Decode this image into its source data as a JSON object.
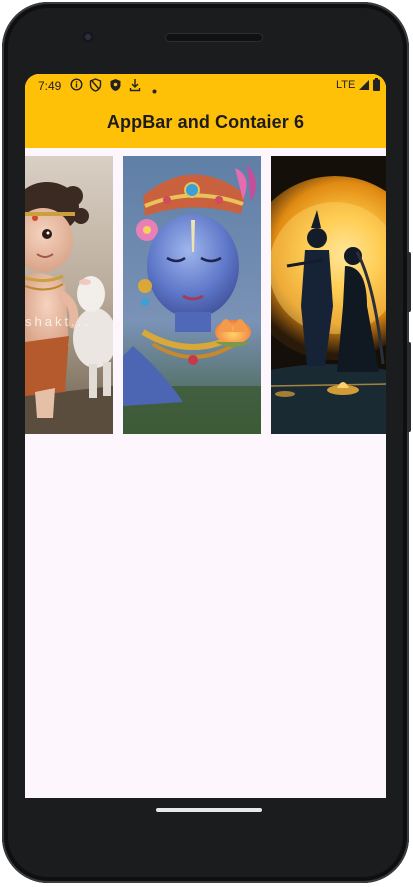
{
  "status_bar": {
    "time": "7:49",
    "network": "LTE",
    "icons": [
      "info-icon",
      "shield-icon",
      "shield-filled-icon",
      "download-icon",
      "dot-icon",
      "signal-icon",
      "battery-icon"
    ]
  },
  "app_bar": {
    "title": "AppBar and Contaier 6",
    "color": "#ffc107"
  },
  "gallery": {
    "images": [
      {
        "name": "child-krishna-with-calf",
        "watermark": "shakt..."
      },
      {
        "name": "krishna-portrait-with-lotus"
      },
      {
        "name": "krishna-radha-silhouette-moon"
      }
    ]
  },
  "colors": {
    "screen_background": "#fdf7fd",
    "device_frame": "#1b1c1e"
  }
}
